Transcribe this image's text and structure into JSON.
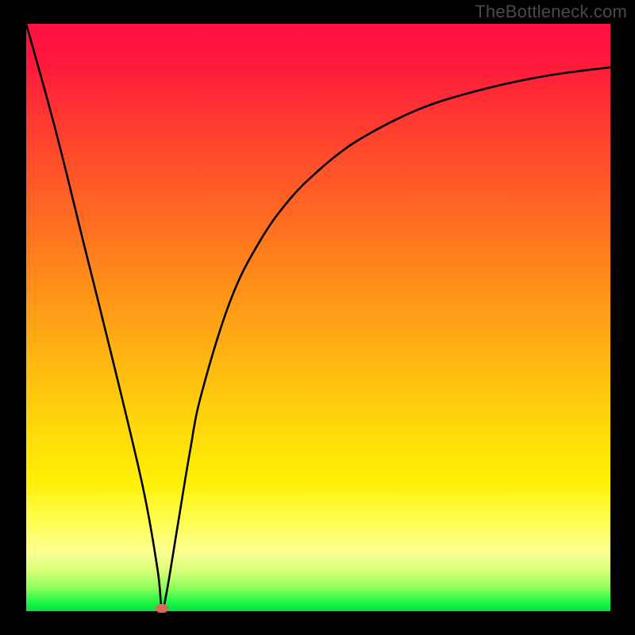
{
  "watermark": "TheBottleneck.com",
  "chart_data": {
    "type": "line",
    "title": "",
    "xlabel": "",
    "ylabel": "",
    "xlim": [
      0,
      100
    ],
    "ylim": [
      0,
      100
    ],
    "grid": false,
    "series": [
      {
        "name": "curve",
        "x": [
          0,
          5,
          10,
          15,
          20,
          22.5,
          23.2,
          24,
          26,
          28,
          30,
          35,
          40,
          45,
          50,
          55,
          60,
          65,
          70,
          75,
          80,
          85,
          90,
          95,
          100
        ],
        "y": [
          100,
          82,
          62,
          42,
          21,
          7,
          0.5,
          3,
          15,
          27,
          37,
          53,
          63,
          70,
          75,
          79,
          82,
          84.5,
          86.5,
          88,
          89.3,
          90.4,
          91.3,
          92,
          92.6
        ]
      }
    ],
    "marker": {
      "x": 23.2,
      "y": 0.5,
      "color": "#d86a5b"
    },
    "gradient_background": {
      "orientation": "vertical",
      "stops": [
        {
          "pos": 0.0,
          "color": "#ff1243"
        },
        {
          "pos": 0.34,
          "color": "#ff6e21"
        },
        {
          "pos": 0.65,
          "color": "#ffce0c"
        },
        {
          "pos": 0.85,
          "color": "#ffff55"
        },
        {
          "pos": 0.96,
          "color": "#8fff5e"
        },
        {
          "pos": 1.0,
          "color": "#03e23a"
        }
      ]
    },
    "legend": false
  }
}
